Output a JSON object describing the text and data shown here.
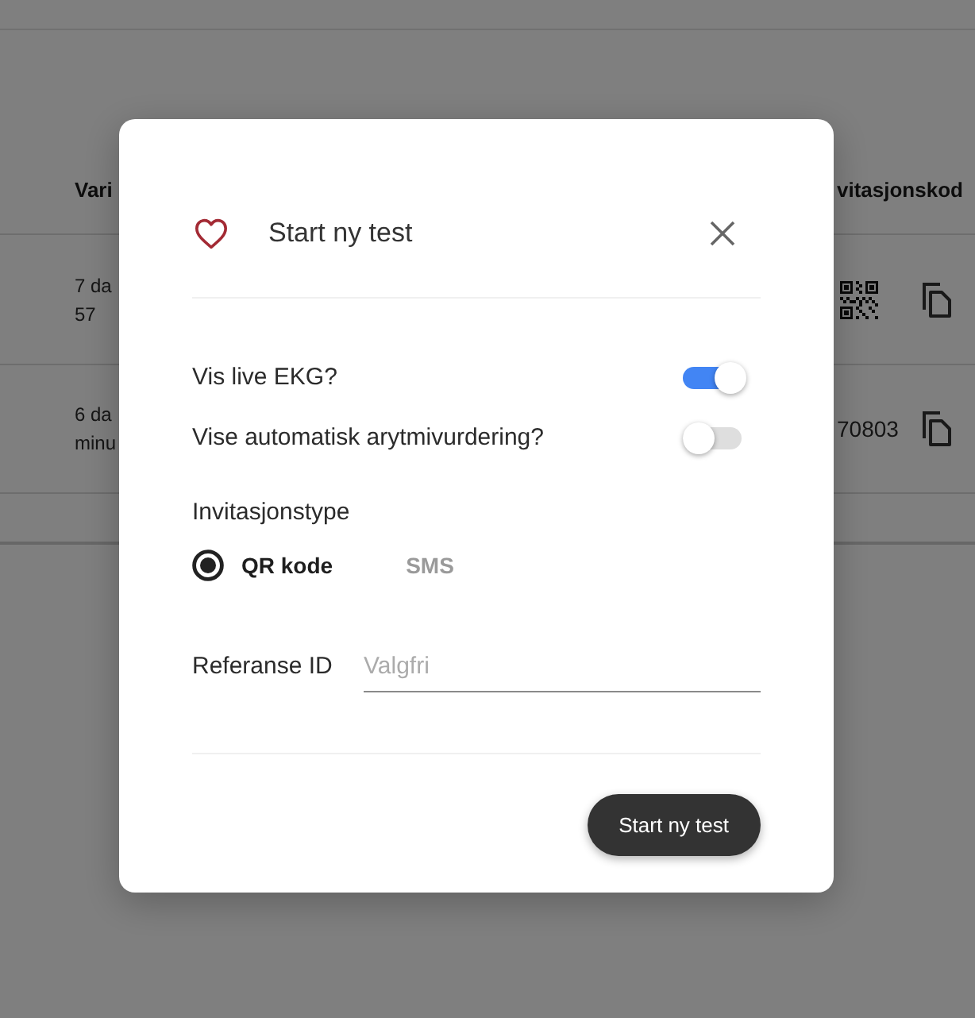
{
  "table": {
    "header_left": "Vari",
    "header_right": "vitasjonskod",
    "rows": [
      {
        "left_lines": [
          "7 da",
          "57"
        ],
        "code": {
          "kind": "qr"
        }
      },
      {
        "left_lines": [
          "6 da",
          "minu"
        ],
        "code": {
          "kind": "text",
          "text": "70803"
        }
      }
    ]
  },
  "dialog": {
    "title": "Start ny test",
    "switches": [
      {
        "label": "Vis live EKG?",
        "on": true
      },
      {
        "label": "Vise automatisk arytmivurdering?",
        "on": false
      }
    ],
    "invitation_type": {
      "label": "Invitasjonstype",
      "options": [
        {
          "label": "QR kode",
          "selected": true
        },
        {
          "label": "SMS",
          "selected": false
        }
      ]
    },
    "reference": {
      "label": "Referanse ID",
      "placeholder": "Valgfri"
    },
    "submit_button": "Start ny test"
  }
}
